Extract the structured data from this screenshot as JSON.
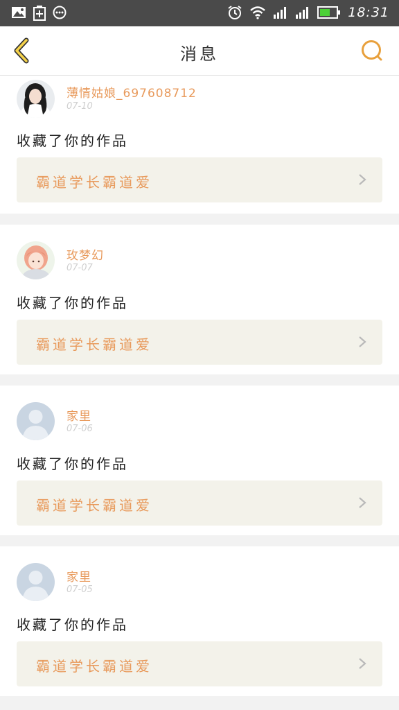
{
  "status_bar": {
    "time": "18:31",
    "left_icons": [
      "image-icon",
      "clipboard-plus-icon",
      "more-dots-icon"
    ],
    "right_icons": [
      "alarm-icon",
      "wifi-icon",
      "signal-icon",
      "signal-icon",
      "battery-icon"
    ],
    "background": "#4a4a4a"
  },
  "header": {
    "title": "消息",
    "back_icon": "chevron-left-icon",
    "search_icon": "search-icon",
    "accent": "#e8a03c"
  },
  "messages": [
    {
      "username": "薄情姑娘_697608712",
      "date": "07-10",
      "action": "收藏了你的作品",
      "work_title": "霸道学长霸道爱",
      "avatar": "photo-avatar"
    },
    {
      "username": "玫梦幻",
      "date": "07-07",
      "action": "收藏了你的作品",
      "work_title": "霸道学长霸道爱",
      "avatar": "anime-avatar"
    },
    {
      "username": "家里",
      "date": "07-06",
      "action": "收藏了你的作品",
      "work_title": "霸道学长霸道爱",
      "avatar": "default-avatar"
    },
    {
      "username": "家里",
      "date": "07-05",
      "action": "收藏了你的作品",
      "work_title": "霸道学长霸道爱",
      "avatar": "default-avatar"
    }
  ],
  "colors": {
    "name": "#e89a5c",
    "work_bg": "#f3f2ea",
    "page_bg": "#f2f2f2"
  }
}
